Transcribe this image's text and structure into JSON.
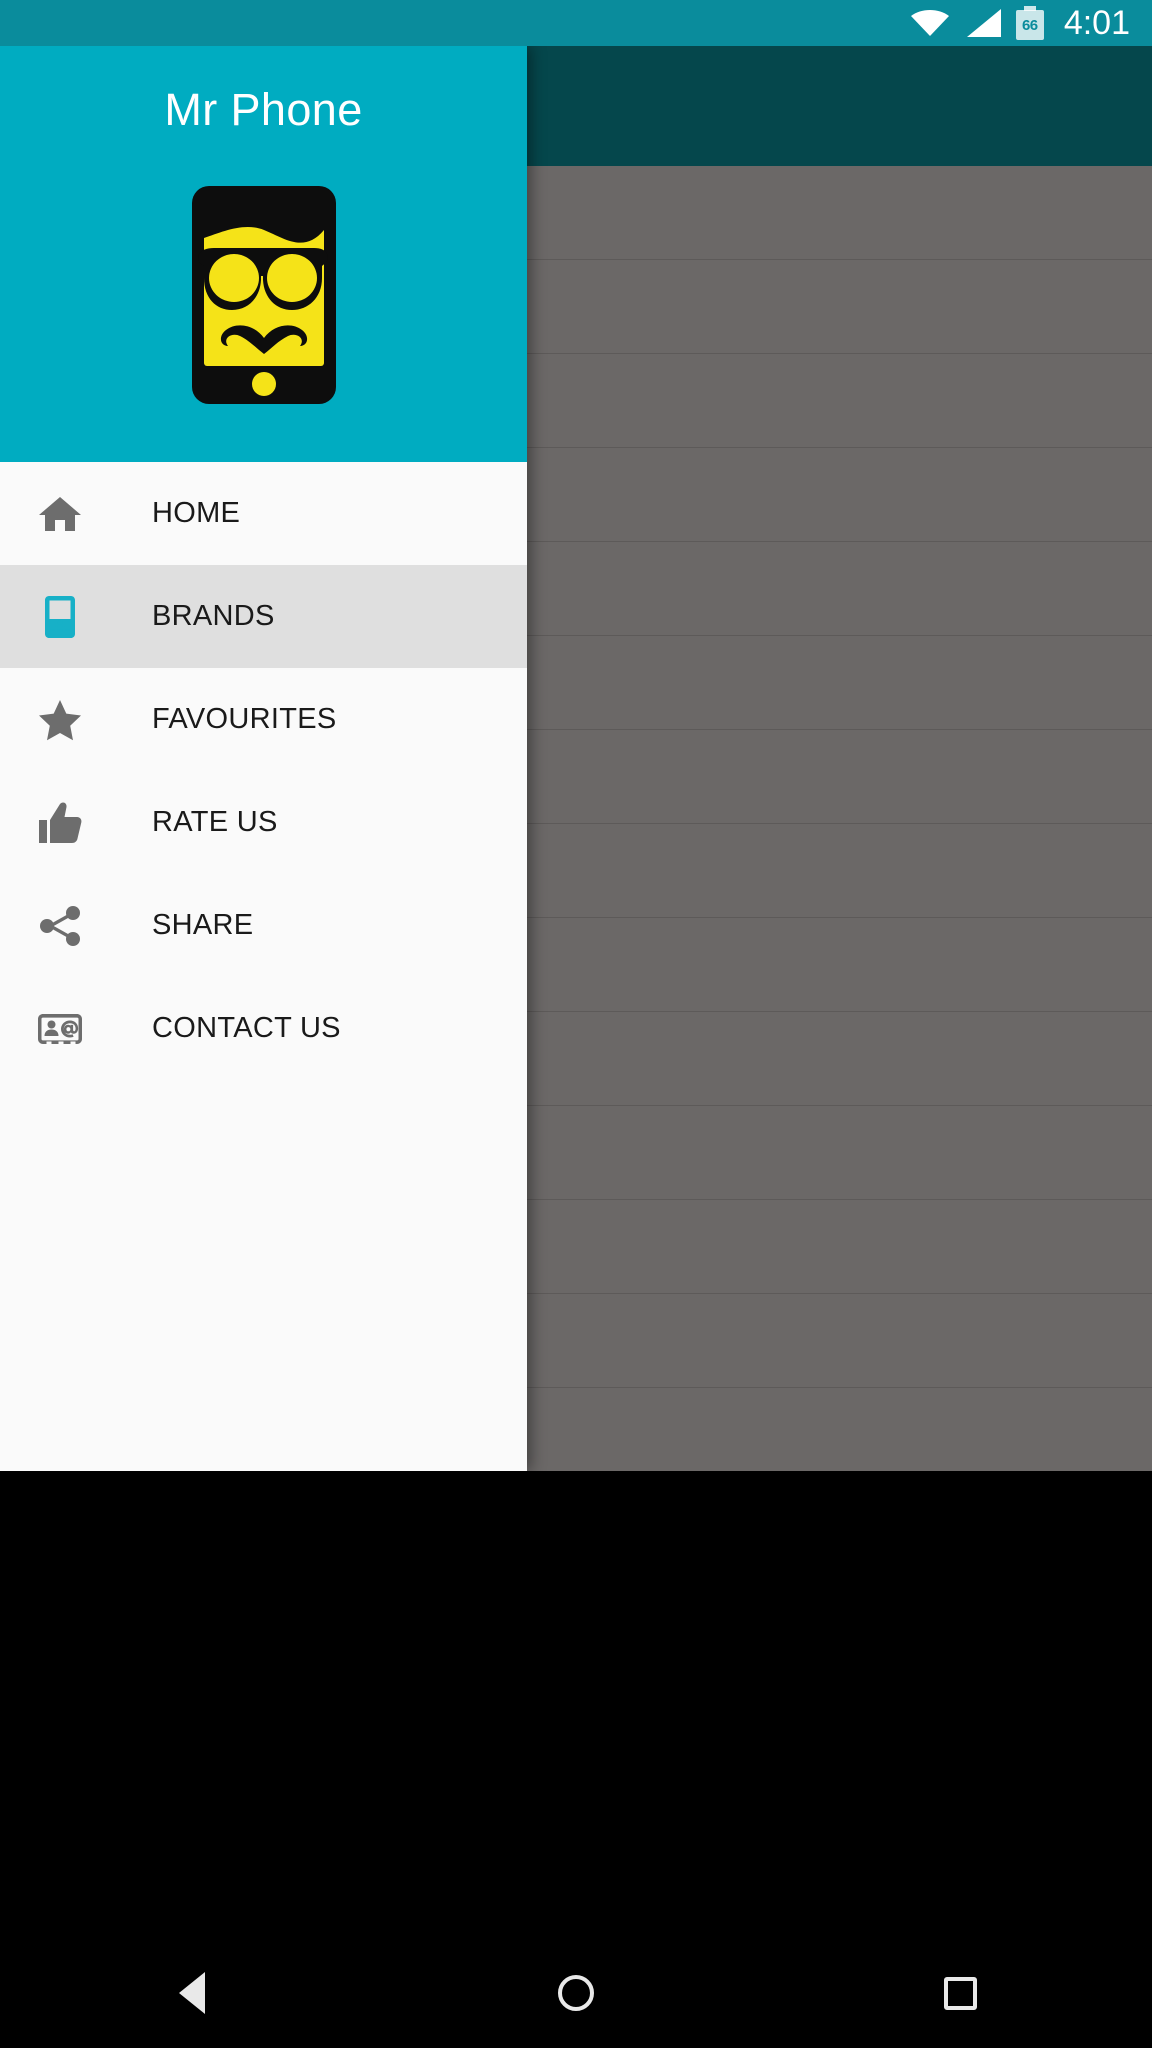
{
  "status_bar": {
    "time": "4:01",
    "battery_level": "66",
    "wifi_icon": "wifi-icon",
    "signal_icon": "signal-icon",
    "battery_icon": "battery-icon",
    "background_color": "#0a8c9c"
  },
  "drawer": {
    "title": "Mr Phone",
    "header_color": "#00acc1",
    "background_color": "#fafafa",
    "selected_color": "#dfdfdf",
    "accent_color": "#00acc1",
    "logo": {
      "name": "mr-phone-logo",
      "phone_color": "#0d0d0d",
      "face_color": "#f5e318"
    },
    "items": [
      {
        "label": "HOME",
        "icon": "home-icon",
        "icon_color": "#6d6d6d",
        "selected": false
      },
      {
        "label": "BRANDS",
        "icon": "phone-icon",
        "icon_color": "#17b0c7",
        "selected": true
      },
      {
        "label": "FAVOURITES",
        "icon": "star-icon",
        "icon_color": "#6d6d6d",
        "selected": false
      },
      {
        "label": "RATE US",
        "icon": "thumbs-up-icon",
        "icon_color": "#6d6d6d",
        "selected": false
      },
      {
        "label": "SHARE",
        "icon": "share-icon",
        "icon_color": "#6d6d6d",
        "selected": false
      },
      {
        "label": "CONTACT US",
        "icon": "contact-card-icon",
        "icon_color": "#6d6d6d",
        "selected": false
      }
    ]
  },
  "content": {
    "toolbar_color": "#05474c",
    "scrim_color": "#6b6867",
    "row_count": 14
  },
  "nav_bar": {
    "back": "back-button",
    "home": "home-button",
    "recents": "recents-button",
    "background_color": "#000000"
  }
}
